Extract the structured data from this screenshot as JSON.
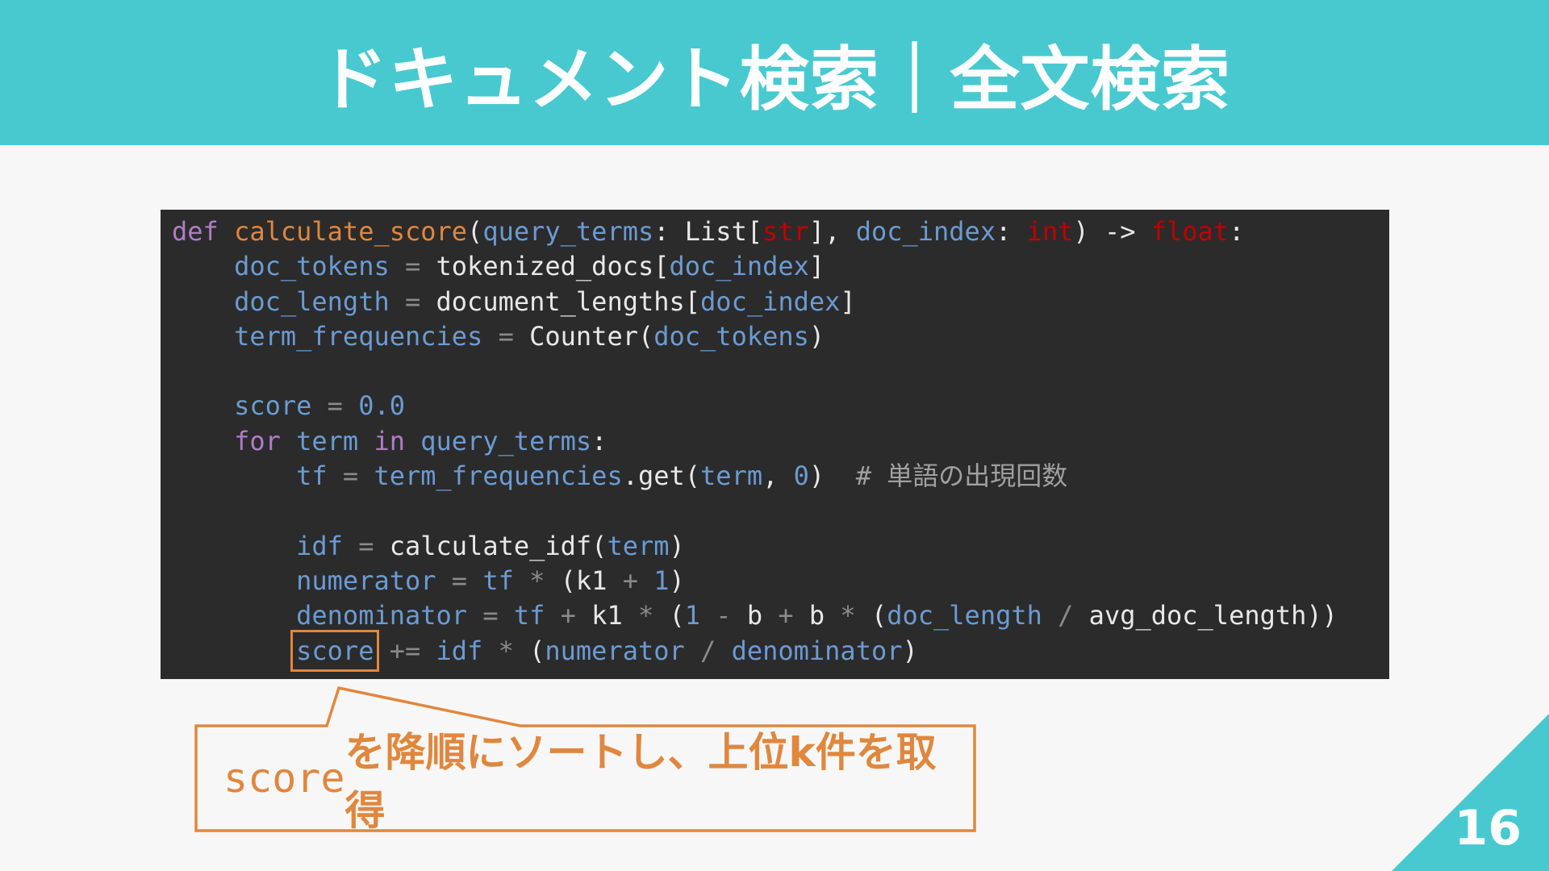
{
  "slide": {
    "title": "ドキュメント検索｜全文検索",
    "page_number": "16",
    "accent_color": "#48c9d0",
    "highlight_color": "#e0873e"
  },
  "code": {
    "language": "python",
    "lines": [
      "def calculate_score(query_terms: List[str], doc_index: int) -> float:",
      "    doc_tokens = tokenized_docs[doc_index]",
      "    doc_length = document_lengths[doc_index]",
      "    term_frequencies = Counter(doc_tokens)",
      "",
      "    score = 0.0",
      "    for term in query_terms:",
      "        tf = term_frequencies.get(term, 0)  # 単語の出現回数",
      "",
      "        idf = calculate_idf(term)",
      "        numerator = tf * (k1 + 1)",
      "        denominator = tf + k1 * (1 - b + b * (doc_length / avg_doc_length))",
      "        score += idf * (numerator / denominator)"
    ],
    "highlighted_token": "score"
  },
  "callout": {
    "code_part": "score",
    "text_part": "を降順にソートし、上位k件を取得"
  }
}
